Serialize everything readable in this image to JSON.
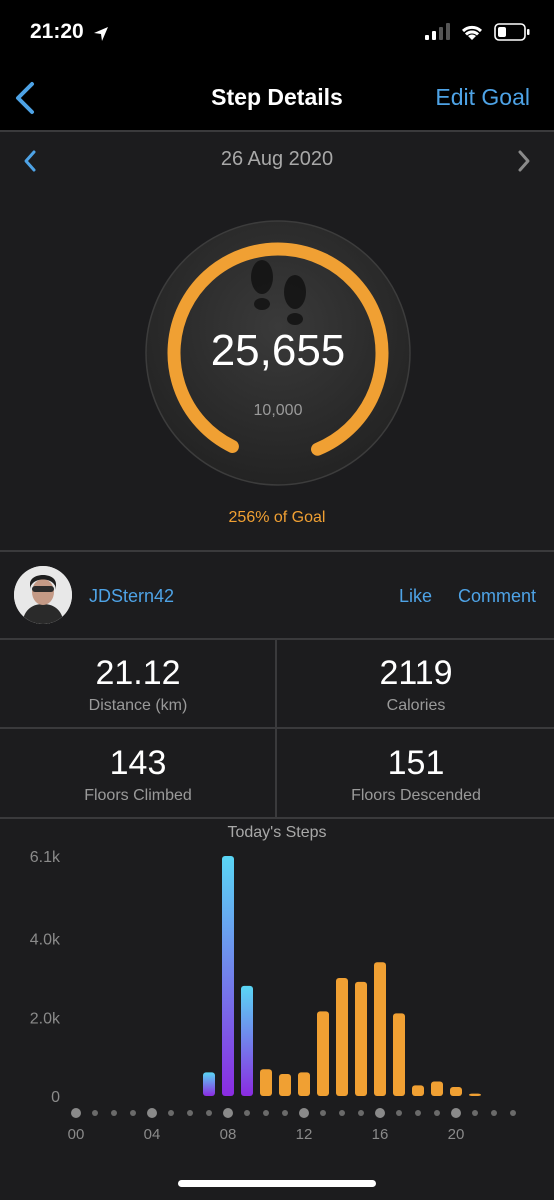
{
  "status_bar": {
    "time": "21:20"
  },
  "nav": {
    "title": "Step Details",
    "edit_goal": "Edit Goal"
  },
  "date": {
    "label": "26 Aug 2020"
  },
  "steps": {
    "count": "25,655",
    "goal": "10,000",
    "goal_percent_text": "256% of Goal"
  },
  "colors": {
    "accent_orange": "#f0a033",
    "link_blue": "#4ea3e6",
    "bar_cyan": "#5ad6f5",
    "bar_purple": "#8a2be2"
  },
  "social": {
    "username": "JDStern42",
    "like": "Like",
    "comment": "Comment"
  },
  "stats": [
    {
      "value": "21.12",
      "label": "Distance (km)"
    },
    {
      "value": "2119",
      "label": "Calories"
    },
    {
      "value": "143",
      "label": "Floors Climbed"
    },
    {
      "value": "151",
      "label": "Floors Descended"
    }
  ],
  "chart_data": {
    "type": "bar",
    "title": "Today's Steps",
    "y_tick_labels": [
      "0",
      "2.0k",
      "4.0k",
      "6.1k"
    ],
    "y_ticks": [
      0,
      2000,
      4000,
      6100
    ],
    "ylim": [
      0,
      6100
    ],
    "x_tick_labels": [
      "00",
      "04",
      "08",
      "12",
      "16",
      "20"
    ],
    "x_ticks": [
      0,
      4,
      8,
      12,
      16,
      20
    ],
    "hours": [
      0,
      1,
      2,
      3,
      4,
      5,
      6,
      7,
      8,
      9,
      10,
      11,
      12,
      13,
      14,
      15,
      16,
      17,
      18,
      19,
      20,
      21,
      22,
      23
    ],
    "values": [
      0,
      0,
      0,
      0,
      0,
      0,
      0,
      600,
      6100,
      2800,
      680,
      560,
      600,
      2150,
      3000,
      2900,
      3400,
      2100,
      270,
      370,
      230,
      60,
      0,
      0
    ],
    "highlight_hours": [
      7,
      8,
      9
    ]
  }
}
